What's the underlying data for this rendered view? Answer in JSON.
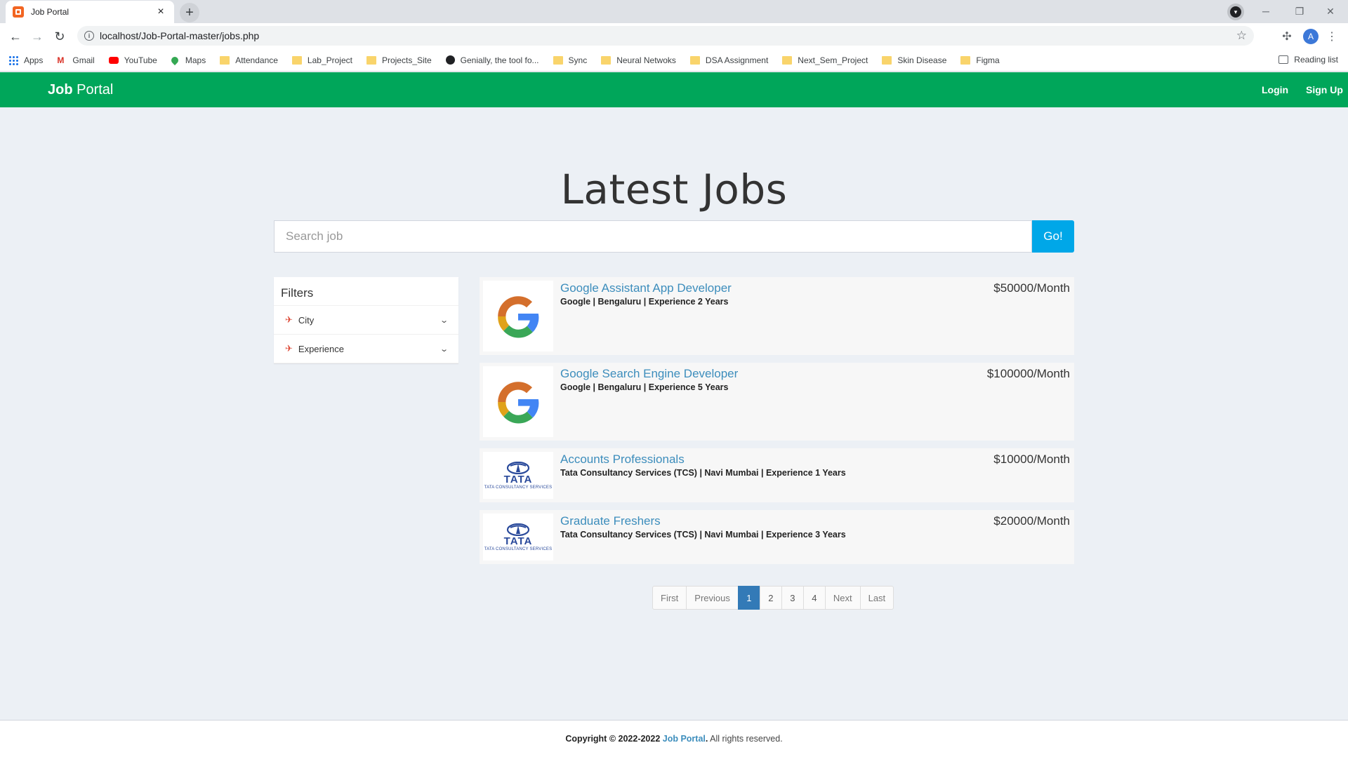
{
  "browser": {
    "tab_title": "Job Portal",
    "tab_close": "×",
    "new_tab": "+",
    "url": "localhost/Job-Portal-master/jobs.php",
    "avatar_letter": "A",
    "bookmarks": [
      {
        "label": "Apps",
        "icon": "apps-grid-icon"
      },
      {
        "label": "Gmail",
        "icon": "gmail-icon"
      },
      {
        "label": "YouTube",
        "icon": "youtube-icon"
      },
      {
        "label": "Maps",
        "icon": "maps-icon"
      },
      {
        "label": "Attendance",
        "icon": "folder-icon"
      },
      {
        "label": "Lab_Project",
        "icon": "folder-icon"
      },
      {
        "label": "Projects_Site",
        "icon": "folder-icon"
      },
      {
        "label": "Genially, the tool fo...",
        "icon": "genially-icon"
      },
      {
        "label": "Sync",
        "icon": "folder-icon"
      },
      {
        "label": "Neural Netwoks",
        "icon": "folder-icon"
      },
      {
        "label": "DSA Assignment",
        "icon": "folder-icon"
      },
      {
        "label": "Next_Sem_Project",
        "icon": "folder-icon"
      },
      {
        "label": "Skin Disease",
        "icon": "folder-icon"
      },
      {
        "label": "Figma",
        "icon": "folder-icon"
      }
    ],
    "reading_list": "Reading list"
  },
  "navbar": {
    "brand_bold": "Job",
    "brand_rest": " Portal",
    "login": "Login",
    "signup": "Sign Up",
    "color": "#00a65a"
  },
  "main": {
    "heading": "Latest Jobs",
    "search_placeholder": "Search job",
    "search_button": "Go!"
  },
  "filters": {
    "title": "Filters",
    "items": [
      {
        "label": "City",
        "icon": "plane-icon"
      },
      {
        "label": "Experience",
        "icon": "plane-icon"
      }
    ]
  },
  "jobs": [
    {
      "title": "Google Assistant App Developer",
      "meta": "Google | Bengaluru | Experience 2 Years",
      "salary": "$50000/Month",
      "logo": "google-logo"
    },
    {
      "title": "Google Search Engine Developer",
      "meta": "Google | Bengaluru | Experience 5 Years",
      "salary": "$100000/Month",
      "logo": "google-logo"
    },
    {
      "title": "Accounts Professionals",
      "meta": "Tata Consultancy Services (TCS) | Navi Mumbai | Experience 1 Years",
      "salary": "$10000/Month",
      "logo": "tata-logo"
    },
    {
      "title": "Graduate Freshers",
      "meta": "Tata Consultancy Services (TCS) | Navi Mumbai | Experience 3 Years",
      "salary": "$20000/Month",
      "logo": "tata-logo"
    }
  ],
  "logos": {
    "tata_name": "TATA",
    "tata_sub": "TATA CONSULTANCY SERVICES"
  },
  "pagination": {
    "first": "First",
    "previous": "Previous",
    "pages": [
      "1",
      "2",
      "3",
      "4"
    ],
    "active_page": "1",
    "next": "Next",
    "last": "Last"
  },
  "footer": {
    "prefix": "Copyright © 2022-2022 ",
    "brand": "Job Portal",
    "suffix": " All rights reserved."
  }
}
